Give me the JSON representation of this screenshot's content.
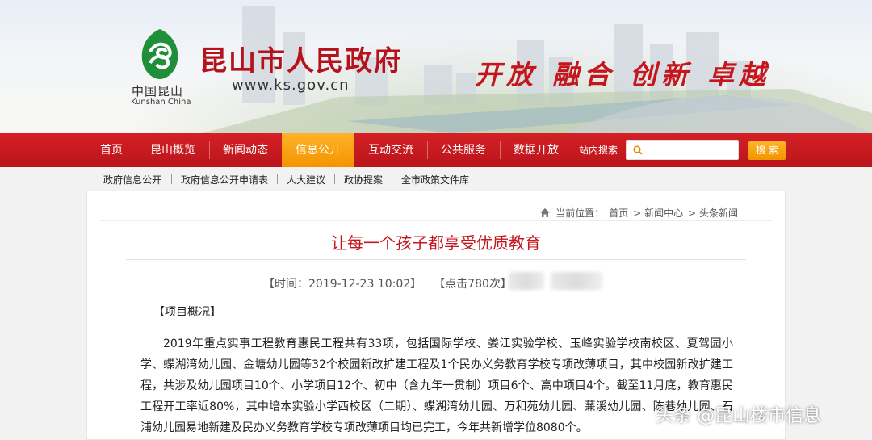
{
  "header": {
    "site_title": "昆山市人民政府",
    "site_url": "www.ks.gov.cn",
    "logo_cn": "中国昆山",
    "logo_en": "Kunshan China",
    "slogan": [
      "开放",
      "融合",
      "创新",
      "卓越"
    ]
  },
  "nav": {
    "items": [
      {
        "label": "首页"
      },
      {
        "label": "昆山概览"
      },
      {
        "label": "新闻动态"
      },
      {
        "label": "信息公开",
        "active": true
      },
      {
        "label": "互动交流"
      },
      {
        "label": "公共服务"
      },
      {
        "label": "数据开放"
      }
    ],
    "search_label": "站内搜索",
    "search_placeholder": "",
    "search_button": "搜 索"
  },
  "subnav": {
    "items": [
      "政府信息公开",
      "政府信息公开申请表",
      "人大建议",
      "政协提案",
      "全市政策文件库"
    ]
  },
  "breadcrumb": {
    "prefix": "当前位置：",
    "items": [
      "首页",
      "> 新闻中心",
      "> 头条新闻"
    ]
  },
  "article": {
    "title": "让每一个孩子都享受优质教育",
    "time": "【时间：2019-12-23 10:02】",
    "clicks": "【点击780次】",
    "section_head": "【项目概况】",
    "paragraph": "2019年重点实事工程教育惠民工程共有33项，包括国际学校、娄江实验学校、玉峰实验学校南校区、夏驾园小学、蝶湖湾幼儿园、金塘幼儿园等32个校园新改扩建工程及1个民办义务教育学校专项改薄项目，其中校园新改扩建工程，共涉及幼儿园项目10个、小学项目12个、初中（含九年一贯制）项目6个、高中项目4个。截至11月底，教育惠民工程开工率近80%，其中培本实验小学西校区（二期）、蝶湖湾幼儿园、万和苑幼儿园、蒹溪幼儿园、陈巷幼儿园、石浦幼儿园易地新建及民办义务教育学校专项改薄项目均已完工，今年共新增学位8080个。"
  },
  "watermark": "头条 @昆山楼市信息",
  "colors": {
    "brand_red": "#c4161c",
    "nav_red": "#c81a20",
    "accent_orange": "#f39400"
  }
}
